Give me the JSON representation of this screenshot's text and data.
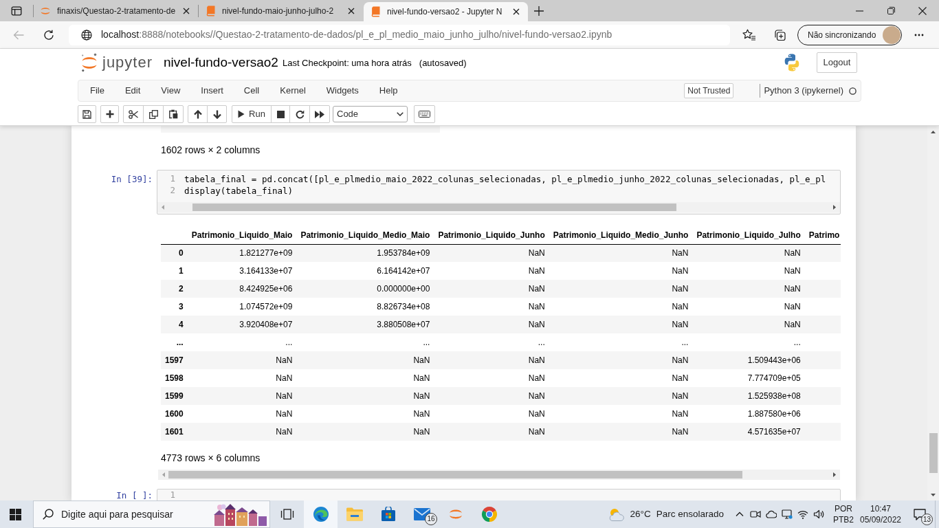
{
  "browser": {
    "tabs": [
      {
        "kind": "jupyter",
        "title": "finaxis/Questao-2-tratamento-de",
        "selected": false
      },
      {
        "kind": "book",
        "title": "nivel-fundo-maio-junho-julho-2",
        "selected": false
      },
      {
        "kind": "book",
        "title": "nivel-fundo-versao2 - Jupyter N",
        "selected": true
      }
    ],
    "address": {
      "host": "localhost",
      "path": ":8888/notebooks//Questao-2-tratamento-de-dados/pl_e_pl_medio_maio_junho_julho/nivel-fundo-versao2.ipynb"
    },
    "profile": {
      "label": "Não sincronizando"
    }
  },
  "jupyter": {
    "logo_text": "jupyter",
    "notebook_name": "nivel-fundo-versao2",
    "checkpoint": "Last Checkpoint: uma hora atrás",
    "autosave_status": "(autosaved)",
    "logout": "Logout",
    "menu": [
      "File",
      "Edit",
      "View",
      "Insert",
      "Cell",
      "Kernel",
      "Widgets",
      "Help"
    ],
    "trust": "Not Trusted",
    "kernel": {
      "name": "Python 3 (ipykernel)",
      "busy": false
    },
    "toolbar": {
      "run_label": "Run",
      "cell_type": "Code"
    }
  },
  "notebook": {
    "previous_output": {
      "summary": "1602 rows × 2 columns"
    },
    "cells": [
      {
        "prompt": "In [39]:",
        "lines": [
          {
            "number": "1",
            "code": "tabela_final = pd.concat([pl_e_plmedio_maio_2022_colunas_selecionadas, pl_e_plmedio_junho_2022_colunas_selecionadas, pl_e_pl"
          },
          {
            "number": "2",
            "code": "display(tabela_final)"
          }
        ],
        "output": {
          "table": {
            "columns": [
              "Patrimonio_Liquido_Maio",
              "Patrimonio_Liquido_Medio_Maio",
              "Patrimonio_Liquido_Junho",
              "Patrimonio_Liquido_Medio_Junho",
              "Patrimonio_Liquido_Julho",
              "Patrimo"
            ],
            "rows": [
              {
                "index": "0",
                "cells": [
                  "1.821277e+09",
                  "1.953784e+09",
                  "NaN",
                  "NaN",
                  "NaN"
                ]
              },
              {
                "index": "1",
                "cells": [
                  "3.164133e+07",
                  "6.164142e+07",
                  "NaN",
                  "NaN",
                  "NaN"
                ]
              },
              {
                "index": "2",
                "cells": [
                  "8.424925e+06",
                  "0.000000e+00",
                  "NaN",
                  "NaN",
                  "NaN"
                ]
              },
              {
                "index": "3",
                "cells": [
                  "1.074572e+09",
                  "8.826734e+08",
                  "NaN",
                  "NaN",
                  "NaN"
                ]
              },
              {
                "index": "4",
                "cells": [
                  "3.920408e+07",
                  "3.880508e+07",
                  "NaN",
                  "NaN",
                  "NaN"
                ]
              },
              {
                "index": "...",
                "cells": [
                  "...",
                  "...",
                  "...",
                  "...",
                  "..."
                ]
              },
              {
                "index": "1597",
                "cells": [
                  "NaN",
                  "NaN",
                  "NaN",
                  "NaN",
                  "1.509443e+06"
                ]
              },
              {
                "index": "1598",
                "cells": [
                  "NaN",
                  "NaN",
                  "NaN",
                  "NaN",
                  "7.774709e+05"
                ]
              },
              {
                "index": "1599",
                "cells": [
                  "NaN",
                  "NaN",
                  "NaN",
                  "NaN",
                  "1.525938e+08"
                ]
              },
              {
                "index": "1600",
                "cells": [
                  "NaN",
                  "NaN",
                  "NaN",
                  "NaN",
                  "1.887580e+06"
                ]
              },
              {
                "index": "1601",
                "cells": [
                  "NaN",
                  "NaN",
                  "NaN",
                  "NaN",
                  "4.571635e+07"
                ]
              }
            ]
          },
          "summary": "4773 rows × 6 columns"
        }
      },
      {
        "prompt": "In [ ]:",
        "lines": [
          {
            "number": "1"
          }
        ]
      }
    ]
  },
  "taskbar": {
    "search": {
      "placeholder": "Digite aqui para pesquisar"
    },
    "apps": [
      {
        "kind": "edge",
        "selected": true
      },
      {
        "kind": "explorer",
        "selected": false
      },
      {
        "kind": "store",
        "selected": false
      },
      {
        "kind": "mail",
        "selected": false,
        "badge": "16"
      },
      {
        "kind": "jupyter",
        "selected": false
      },
      {
        "kind": "chrome",
        "selected": false
      }
    ],
    "weather": {
      "temperature": "26°C",
      "condition": "Parc ensolarado"
    },
    "language": {
      "code": "POR",
      "layout": "PTB2"
    },
    "clock": {
      "time": "10:47",
      "date": "05/09/2022"
    },
    "notifications": {
      "badge": "13"
    }
  }
}
